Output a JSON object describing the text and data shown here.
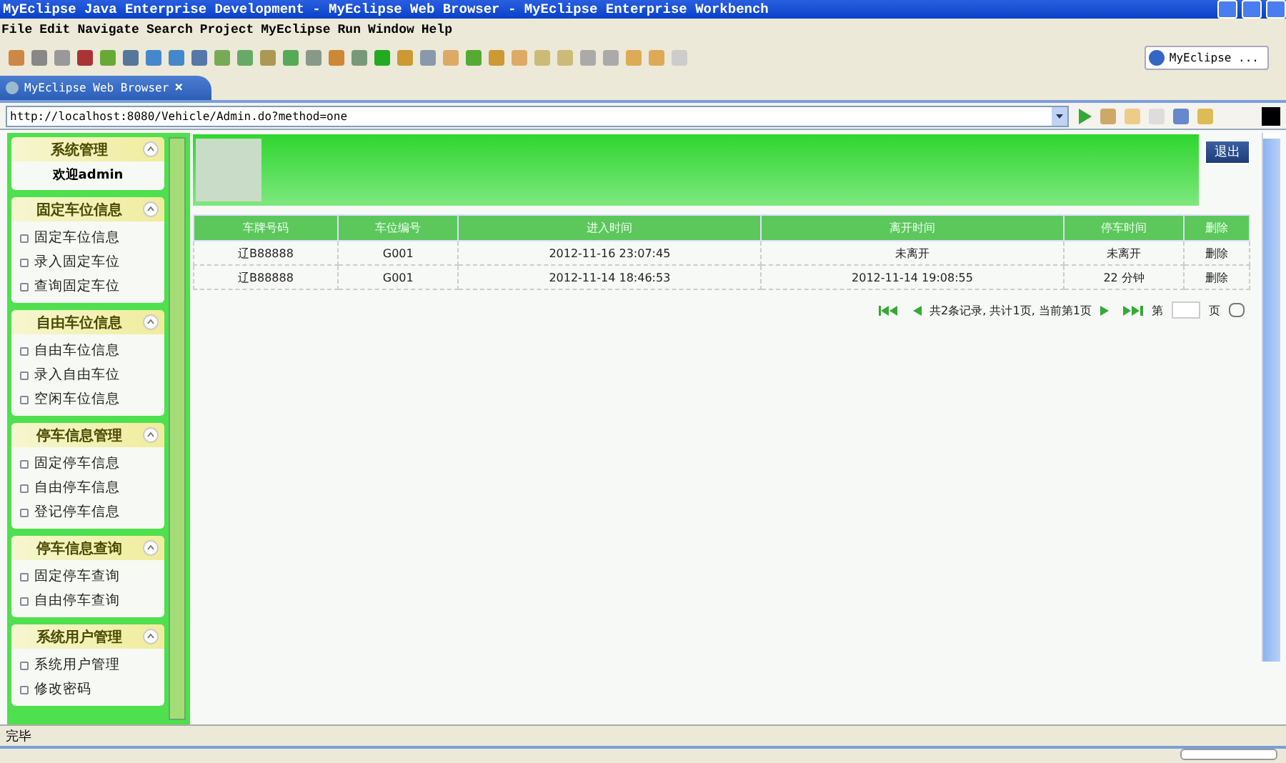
{
  "window": {
    "title": "MyEclipse Java Enterprise Development - MyEclipse Web Browser - MyEclipse Enterprise Workbench"
  },
  "menu": [
    "File",
    "Edit",
    "Navigate",
    "Search",
    "Project",
    "MyEclipse",
    "Run",
    "Window",
    "Help"
  ],
  "perspective": "MyEclipse ...",
  "editor_tab": {
    "label": "MyEclipse Web Browser",
    "close": "×"
  },
  "address": "http://localhost:8080/Vehicle/Admin.do?method=one",
  "sidebar": {
    "sections": [
      {
        "title": "系统管理",
        "welcome": "欢迎admin"
      },
      {
        "title": "固定车位信息",
        "items": [
          "固定车位信息",
          "录入固定车位",
          "查询固定车位"
        ]
      },
      {
        "title": "自由车位信息",
        "items": [
          "自由车位信息",
          "录入自由车位",
          "空闲车位信息"
        ]
      },
      {
        "title": "停车信息管理",
        "items": [
          "固定停车信息",
          "自由停车信息",
          "登记停车信息"
        ]
      },
      {
        "title": "停车信息查询",
        "items": [
          "固定停车查询",
          "自由停车查询"
        ]
      },
      {
        "title": "系统用户管理",
        "items": [
          "系统用户管理",
          "修改密码"
        ]
      }
    ]
  },
  "header": {
    "logout": "退出"
  },
  "table": {
    "columns": [
      "车牌号码",
      "车位编号",
      "进入时间",
      "离开时间",
      "停车时间",
      "删除"
    ],
    "rows": [
      [
        "辽B88888",
        "G001",
        "2012-11-16 23:07:45",
        "未离开",
        "未离开",
        "删除"
      ],
      [
        "辽B88888",
        "G001",
        "2012-11-14 18:46:53",
        "2012-11-14 19:08:55",
        "22 分钟",
        "删除"
      ]
    ]
  },
  "pager": {
    "summary": "共2条记录, 共计1页, 当前第1页",
    "page_prefix": "第",
    "page_suffix": "页"
  },
  "status_bar": "完毕"
}
